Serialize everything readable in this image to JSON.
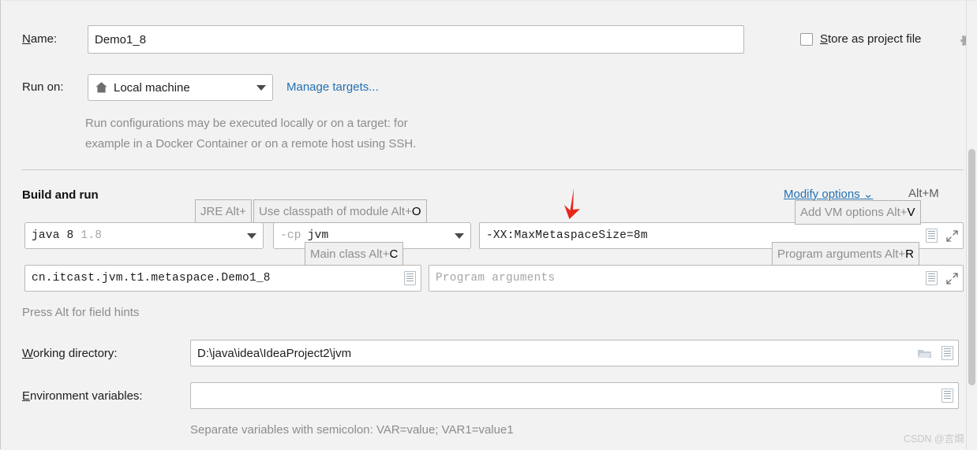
{
  "name_row": {
    "label": "Name:",
    "label_mnemonic": "N",
    "value": "Demo1_8"
  },
  "store_as_project_file": {
    "label": "Store as project file",
    "label_mnemonic": "S",
    "checked": false,
    "gear_icon": "gear-icon"
  },
  "run_on": {
    "label": "Run on:",
    "selected": "Local machine",
    "icon": "home-icon",
    "manage_link": "Manage targets...",
    "description_line1": "Run configurations may be executed locally or on a target: for",
    "description_line2": "example in a Docker Container or on a remote host using SSH."
  },
  "build_and_run": {
    "title": "Build and run",
    "modify_options_link": "Modify options",
    "modify_options_shortcut": "Alt+M",
    "jre": {
      "value_bold": "java 8",
      "value_dim": "1.8"
    },
    "classpath": {
      "prefix": "-cp",
      "module": "jvm"
    },
    "vm_options": {
      "value": "-XX:MaxMetaspaceSize=8m"
    },
    "main_class": {
      "value": "cn.itcast.jvm.t1.metaspace.Demo1_8"
    },
    "program_arguments": {
      "placeholder": "Program arguments",
      "value": ""
    },
    "field_hints": {
      "jre": "JRE Alt+",
      "use_classpath": "Use classpath of module Alt+",
      "use_classpath_key": "O",
      "add_vm_options": "Add VM options Alt+",
      "add_vm_options_key": "V",
      "main_class": "Main class Alt+",
      "main_class_key": "C",
      "program_arguments": "Program arguments Alt+",
      "program_arguments_key": "R"
    },
    "alt_hint": "Press Alt for field hints"
  },
  "working_directory": {
    "label": "Working directory:",
    "label_mnemonic": "W",
    "value": "D:\\java\\idea\\IdeaProject2\\jvm",
    "browse_icon": "folder-icon",
    "macro_icon": "macro-icon"
  },
  "environment_variables": {
    "label": "Environment variables:",
    "label_mnemonic": "E",
    "value": "",
    "macro_icon": "macro-icon",
    "hint": "Separate variables with semicolon: VAR=value; VAR1=value1"
  },
  "annotation": {
    "arrow_color": "#e8261c"
  },
  "watermark": "CSDN @言烱",
  "colors": {
    "background": "#f2f2f2",
    "field_background": "#ffffff",
    "link": "#2470b3",
    "hint_text": "#8c8c8c",
    "border": "#b9b9b9"
  }
}
